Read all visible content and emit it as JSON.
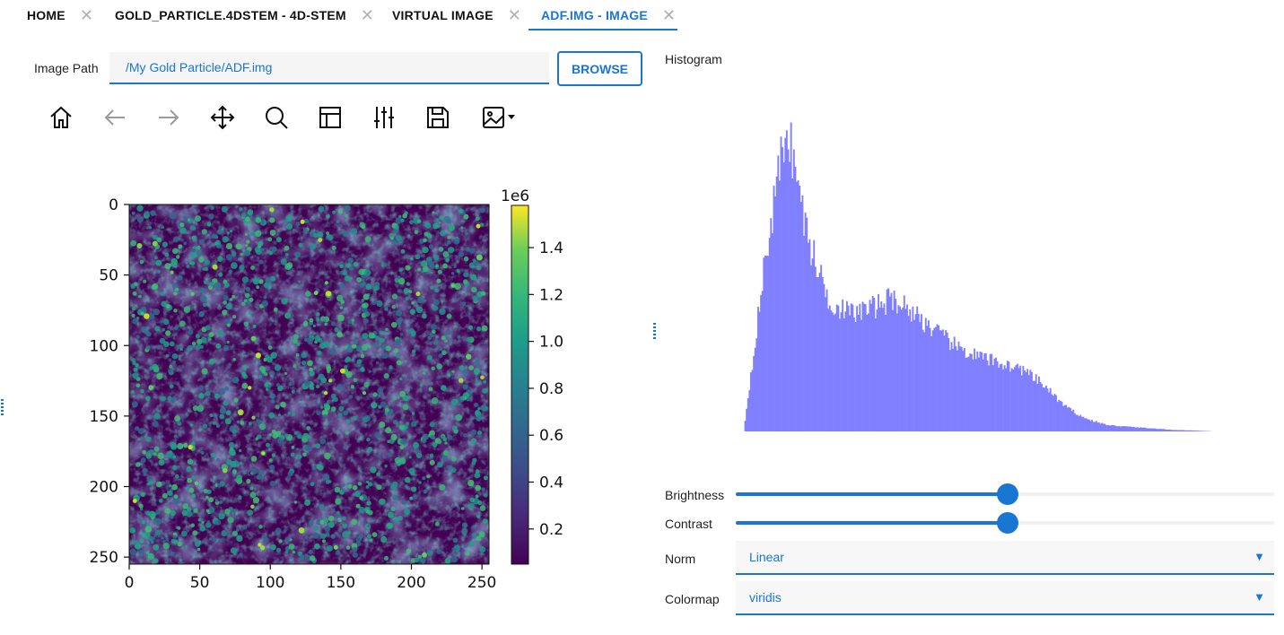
{
  "tabs": [
    {
      "label": "HOME",
      "close_icon": "close-icon"
    },
    {
      "label": "GOLD_PARTICLE.4DSTEM - 4D-STEM",
      "close_icon": "close-icon"
    },
    {
      "label": "VIRTUAL IMAGE",
      "close_icon": "close-icon"
    },
    {
      "label": "ADF.IMG - IMAGE",
      "close_icon": "close-icon",
      "active": true
    }
  ],
  "image_path": {
    "label": "Image Path",
    "value": "/My Gold Particle/ADF.img",
    "browse_label": "BROWSE"
  },
  "toolbar": {
    "tools": [
      "home-icon",
      "back-arrow-icon",
      "forward-arrow-icon",
      "pan-icon",
      "zoom-icon",
      "subplots-icon",
      "adjust-sliders-icon",
      "save-icon",
      "image-dropdown-icon"
    ]
  },
  "colors": {
    "accent": "#1976d2",
    "histogram_fill": "#8080ff",
    "tab_close": "#b0b0b0"
  },
  "chart_data": [
    {
      "type": "heatmap",
      "colormap": "viridis",
      "x_ticks": [
        "0",
        "50",
        "100",
        "150",
        "200",
        "250"
      ],
      "y_ticks": [
        "0",
        "50",
        "100",
        "150",
        "200",
        "250"
      ],
      "xlim": [
        0,
        255
      ],
      "ylim": [
        255,
        0
      ],
      "colorbar": {
        "multiplier_label": "1e6",
        "ticks": [
          "0.2",
          "0.4",
          "0.6",
          "0.8",
          "1.0",
          "1.2",
          "1.4"
        ],
        "range": [
          0.05,
          1.58
        ]
      }
    },
    {
      "type": "bar",
      "title": "Histogram",
      "color": "#8080ff",
      "shape_note": "sharp peak near low intensity, secondary hump, long tail",
      "envelope": [
        0,
        0.55,
        1.0,
        0.62,
        0.42,
        0.38,
        0.4,
        0.43,
        0.38,
        0.32,
        0.27,
        0.24,
        0.22,
        0.2,
        0.15,
        0.08,
        0.04,
        0.02,
        0.015,
        0.01,
        0.005,
        0.003,
        0
      ]
    }
  ],
  "controls": {
    "brightness": {
      "label": "Brightness",
      "value": 0.505
    },
    "contrast": {
      "label": "Contrast",
      "value": 0.505
    },
    "norm": {
      "label": "Norm",
      "value": "Linear"
    },
    "colormap": {
      "label": "Colormap",
      "value": "viridis"
    },
    "dropdown_icon": "triangle-down-icon"
  }
}
